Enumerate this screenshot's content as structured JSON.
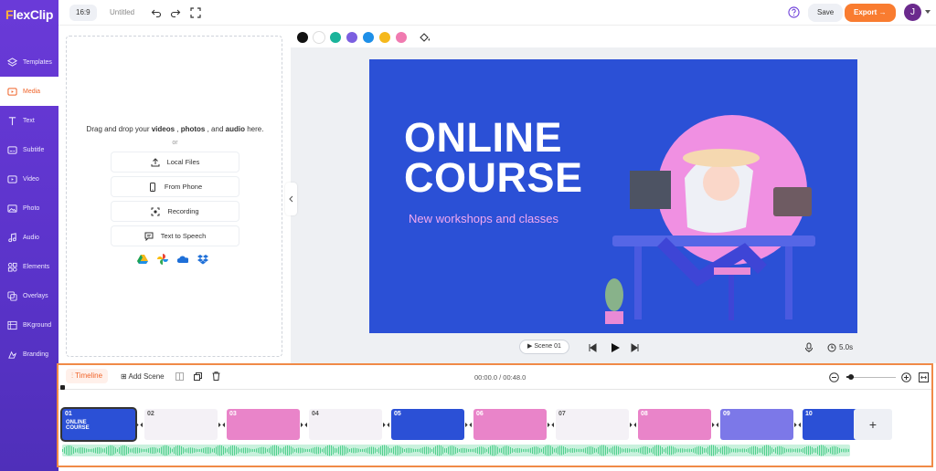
{
  "app": {
    "logo_initial": "F",
    "logo_rest": "lexClip"
  },
  "topbar": {
    "ratio": "16:9",
    "title": "Untitled",
    "save": "Save",
    "export": "Export",
    "avatar": "J"
  },
  "sidebar": {
    "items": [
      {
        "label": "Templates",
        "icon": "templates-icon"
      },
      {
        "label": "Media",
        "icon": "media-icon",
        "active": true
      },
      {
        "label": "Text",
        "icon": "text-icon"
      },
      {
        "label": "Subtitle",
        "icon": "subtitle-icon"
      },
      {
        "label": "Video",
        "icon": "video-icon"
      },
      {
        "label": "Photo",
        "icon": "photo-icon"
      },
      {
        "label": "Audio",
        "icon": "audio-icon"
      },
      {
        "label": "Elements",
        "icon": "elements-icon"
      },
      {
        "label": "Overlays",
        "icon": "overlays-icon"
      },
      {
        "label": "BKground",
        "icon": "background-icon"
      },
      {
        "label": "Branding",
        "icon": "branding-icon"
      }
    ]
  },
  "media": {
    "drop_prefix": "Drag and drop your ",
    "drop_videos": "videos",
    "drop_sep1": " , ",
    "drop_photos": "photos",
    "drop_sep2": " , and ",
    "drop_audio": "audio",
    "drop_suffix": " here.",
    "or": "or",
    "buttons": [
      "Local Files",
      "From Phone",
      "Recording",
      "Text to Speech"
    ]
  },
  "colors": {
    "swatches": [
      "#111111",
      "#ffffff",
      "#19b39a",
      "#7b5fe0",
      "#1e8fe8",
      "#f5b81c",
      "#f07ab0"
    ],
    "accent": "#f97c30"
  },
  "scene": {
    "headline1": "ONLINE",
    "headline2": "COURSE",
    "subtitle": "New workshops and classes"
  },
  "playbar": {
    "scene_label": "Scene 01",
    "duration": "5.0s"
  },
  "timeline": {
    "tab": "Timeline",
    "add_scene": "Add Scene",
    "time": "00:00.0 / 00:48.0",
    "zoom_level": 0.1,
    "clips": [
      {
        "num": "01",
        "color": "#2b50d6",
        "label": "ONLINE COURSE"
      },
      {
        "num": "02",
        "color": "#f4f1f6",
        "label": ""
      },
      {
        "num": "03",
        "color": "#e984c9",
        "label": ""
      },
      {
        "num": "04",
        "color": "#f4f1f6",
        "label": ""
      },
      {
        "num": "05",
        "color": "#2b50d6",
        "label": ""
      },
      {
        "num": "06",
        "color": "#e984c9",
        "label": ""
      },
      {
        "num": "07",
        "color": "#f4f1f6",
        "label": ""
      },
      {
        "num": "08",
        "color": "#e984c9",
        "label": ""
      },
      {
        "num": "09",
        "color": "#7c78e8",
        "label": ""
      },
      {
        "num": "10",
        "color": "#2b50d6",
        "label": ""
      }
    ],
    "add_clip": "+"
  }
}
